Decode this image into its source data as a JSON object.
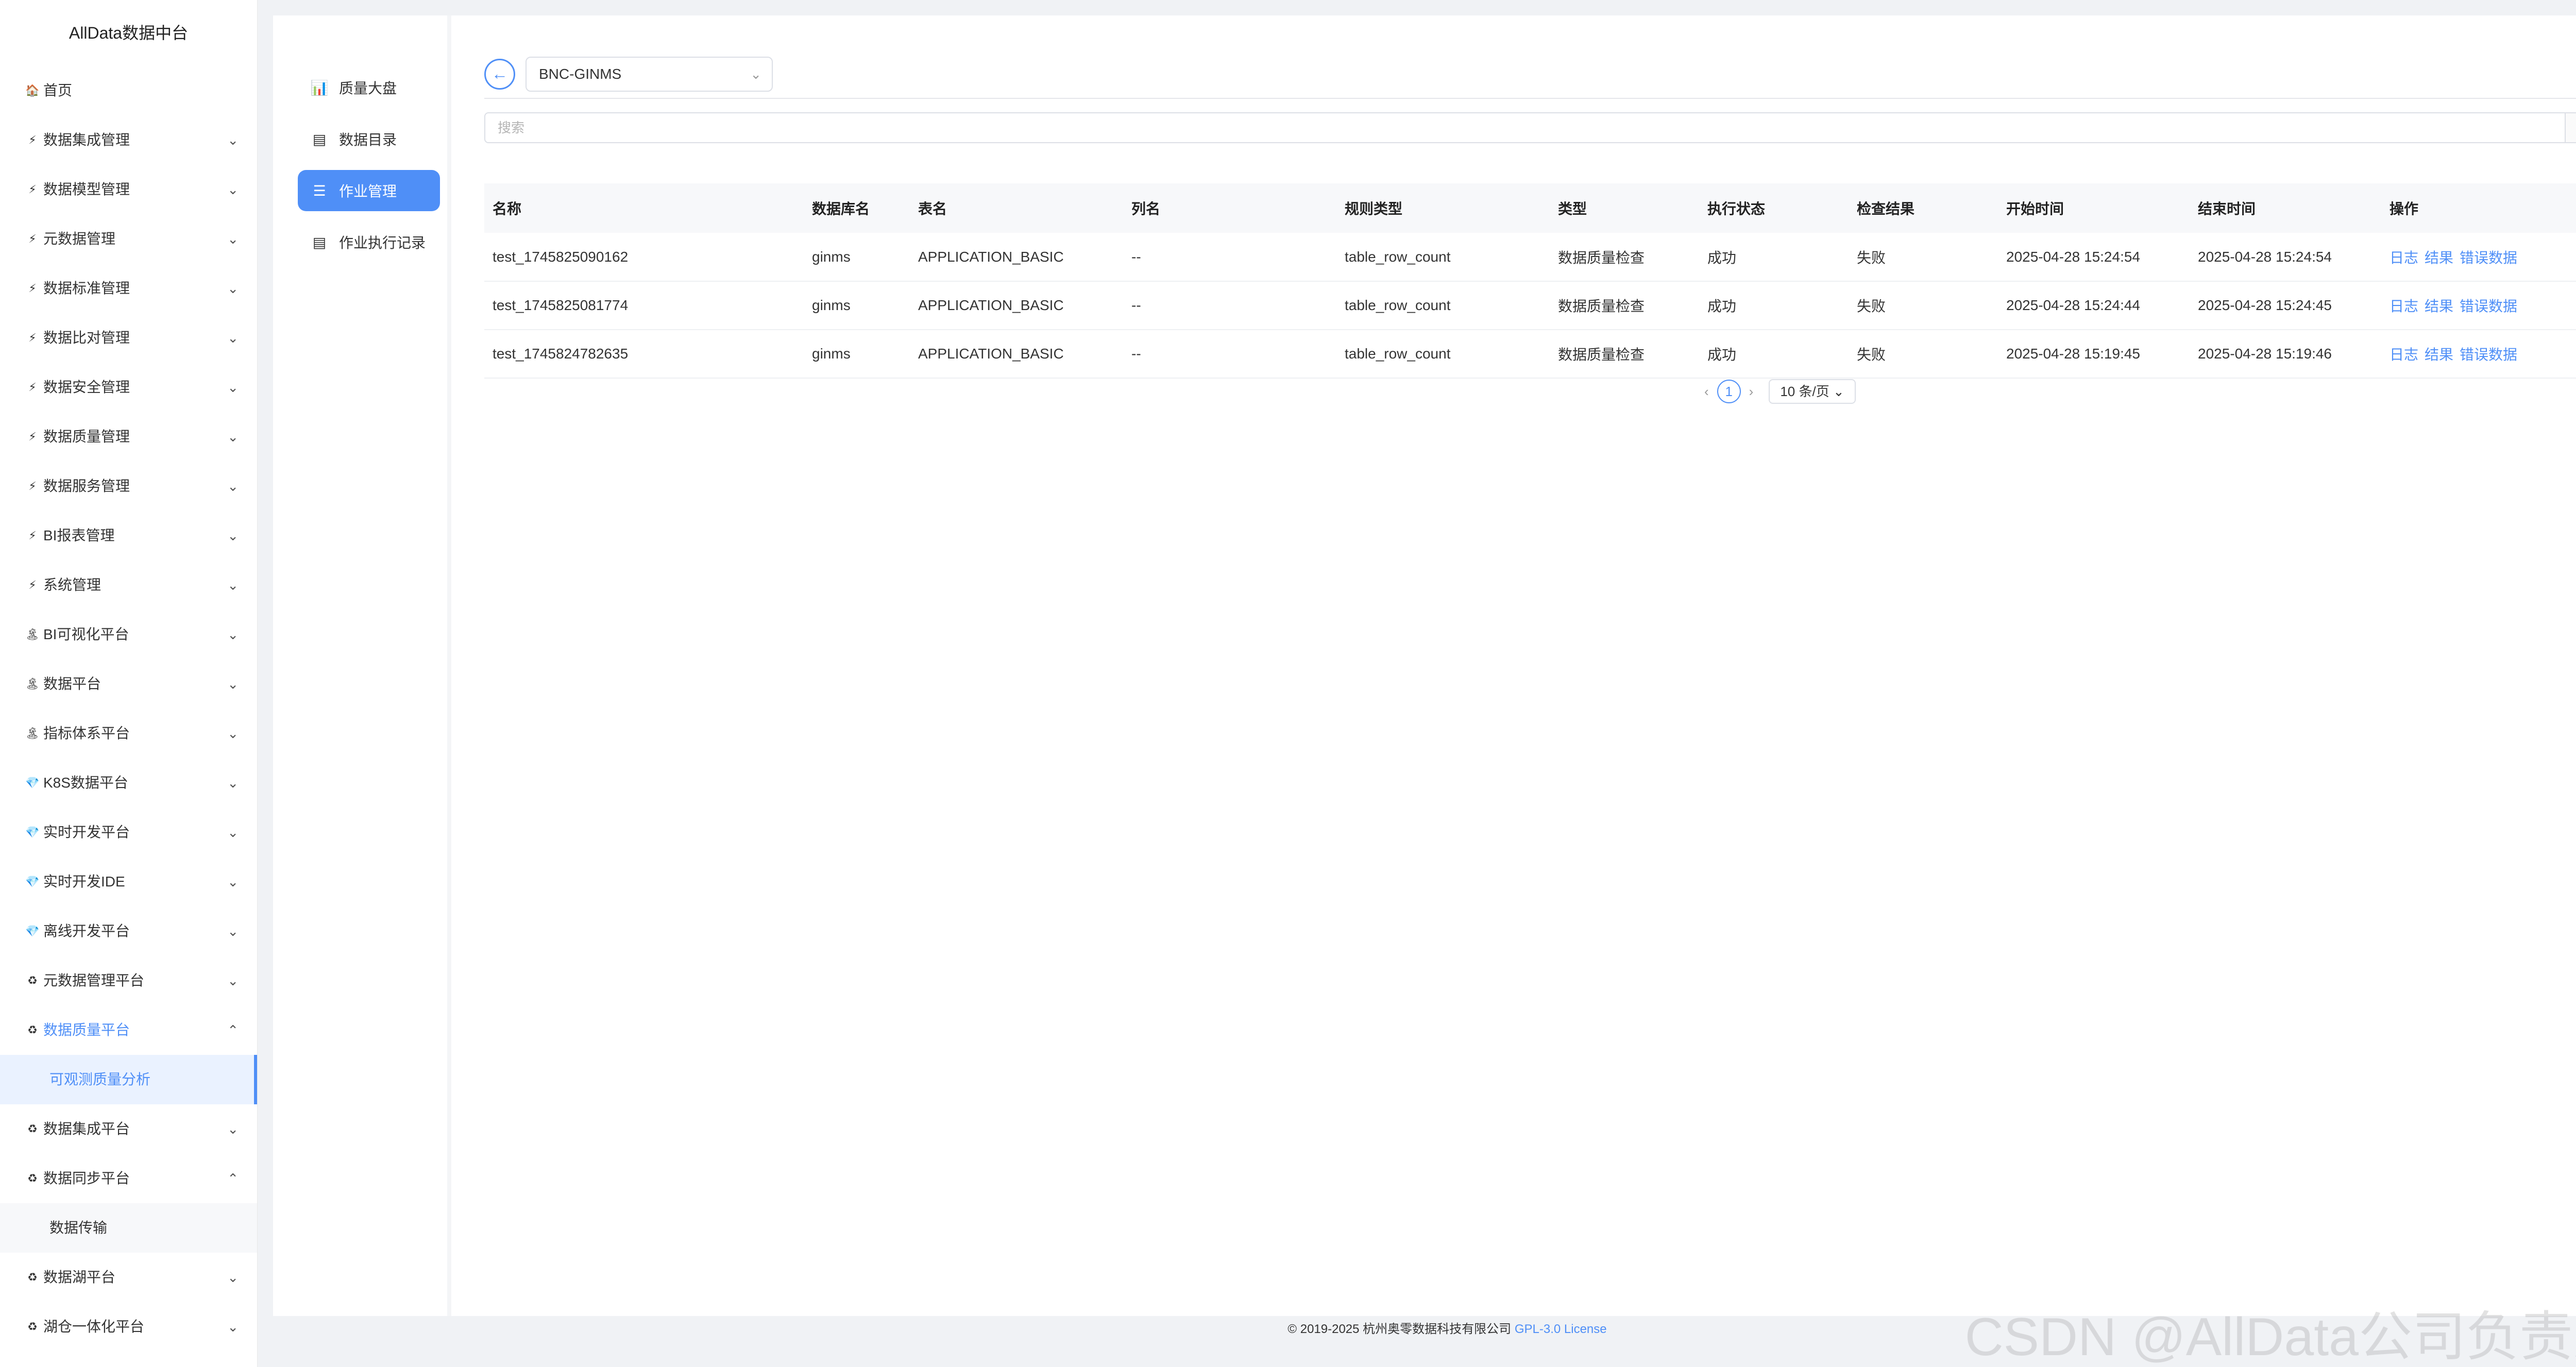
{
  "app": {
    "brand": "AllData数据中台"
  },
  "colors": {
    "accent": "#4f8ff7",
    "background": "#f0f2f5"
  },
  "sidebar": {
    "items": [
      {
        "label": "首页",
        "icon": "home-icon",
        "glyph": "🏠",
        "expanded": null
      },
      {
        "label": "数据集成管理",
        "icon": "bolt-icon",
        "glyph": "⚡",
        "expanded": false
      },
      {
        "label": "数据模型管理",
        "icon": "bolt-icon",
        "glyph": "⚡",
        "expanded": false
      },
      {
        "label": "元数据管理",
        "icon": "bolt-icon",
        "glyph": "⚡",
        "expanded": false
      },
      {
        "label": "数据标准管理",
        "icon": "bolt-icon",
        "glyph": "⚡",
        "expanded": false
      },
      {
        "label": "数据比对管理",
        "icon": "bolt-icon",
        "glyph": "⚡",
        "expanded": false
      },
      {
        "label": "数据安全管理",
        "icon": "bolt-icon",
        "glyph": "⚡",
        "expanded": false
      },
      {
        "label": "数据质量管理",
        "icon": "bolt-icon",
        "glyph": "⚡",
        "expanded": false
      },
      {
        "label": "数据服务管理",
        "icon": "bolt-icon",
        "glyph": "⚡",
        "expanded": false
      },
      {
        "label": "BI报表管理",
        "icon": "bolt-icon",
        "glyph": "⚡",
        "expanded": false
      },
      {
        "label": "系统管理",
        "icon": "bolt-icon",
        "glyph": "⚡",
        "expanded": false
      },
      {
        "label": "BI可视化平台",
        "icon": "tree-icon",
        "glyph": "🏝",
        "expanded": false
      },
      {
        "label": "数据平台",
        "icon": "tree-icon",
        "glyph": "🏝",
        "expanded": false
      },
      {
        "label": "指标体系平台",
        "icon": "tree-icon",
        "glyph": "🏝",
        "expanded": false
      },
      {
        "label": "K8S数据平台",
        "icon": "gem-icon",
        "glyph": "💎",
        "expanded": false
      },
      {
        "label": "实时开发平台",
        "icon": "gem-icon",
        "glyph": "💎",
        "expanded": false
      },
      {
        "label": "实时开发IDE",
        "icon": "gem-icon",
        "glyph": "💎",
        "expanded": false
      },
      {
        "label": "离线开发平台",
        "icon": "gem-icon",
        "glyph": "💎",
        "expanded": false
      },
      {
        "label": "元数据管理平台",
        "icon": "cycle-icon",
        "glyph": "♻",
        "expanded": false
      },
      {
        "label": "数据质量平台",
        "icon": "cycle-icon",
        "glyph": "♻",
        "expanded": true,
        "active": true,
        "children": [
          {
            "label": "可观测质量分析",
            "active": true
          }
        ]
      },
      {
        "label": "数据集成平台",
        "icon": "cycle-icon",
        "glyph": "♻",
        "expanded": false
      },
      {
        "label": "数据同步平台",
        "icon": "cycle-icon",
        "glyph": "♻",
        "expanded": true,
        "children": [
          {
            "label": "数据传输",
            "active": false
          }
        ]
      },
      {
        "label": "数据湖平台",
        "icon": "cycle-icon",
        "glyph": "♻",
        "expanded": false
      },
      {
        "label": "湖仓一体化平台",
        "icon": "cycle-icon",
        "glyph": "♻",
        "expanded": false
      }
    ]
  },
  "subnav": {
    "items": [
      {
        "label": "质量大盘",
        "icon": "bar-chart-icon",
        "glyph": "📊",
        "active": false
      },
      {
        "label": "数据目录",
        "icon": "catalog-icon",
        "glyph": "▤",
        "active": false
      },
      {
        "label": "作业管理",
        "icon": "list-icon",
        "glyph": "☰",
        "active": true
      },
      {
        "label": "作业执行记录",
        "icon": "record-icon",
        "glyph": "▤",
        "active": false
      }
    ]
  },
  "toolbar": {
    "back_glyph": "←",
    "database": "BNC-GINMS",
    "dropdown_glyph": "⌄"
  },
  "search": {
    "placeholder": "搜索",
    "button_glyph": "⌕"
  },
  "table": {
    "columns": [
      "名称",
      "数据库名",
      "表名",
      "列名",
      "规则类型",
      "类型",
      "执行状态",
      "检查结果",
      "开始时间",
      "结束时间",
      "操作"
    ],
    "rows": [
      {
        "name": "test_1745825090162",
        "database": "ginms",
        "table": "APPLICATION_BASIC",
        "column": "--",
        "rule_type": "table_row_count",
        "type": "数据质量检查",
        "status": "成功",
        "result": "失败",
        "start": "2025-04-28 15:24:54",
        "end": "2025-04-28 15:24:54"
      },
      {
        "name": "test_1745825081774",
        "database": "ginms",
        "table": "APPLICATION_BASIC",
        "column": "--",
        "rule_type": "table_row_count",
        "type": "数据质量检查",
        "status": "成功",
        "result": "失败",
        "start": "2025-04-28 15:24:44",
        "end": "2025-04-28 15:24:45"
      },
      {
        "name": "test_1745824782635",
        "database": "ginms",
        "table": "APPLICATION_BASIC",
        "column": "--",
        "rule_type": "table_row_count",
        "type": "数据质量检查",
        "status": "成功",
        "result": "失败",
        "start": "2025-04-28 15:19:45",
        "end": "2025-04-28 15:19:46"
      }
    ],
    "actions": [
      "日志",
      "结果",
      "错误数据"
    ]
  },
  "pagination": {
    "prev_glyph": "‹",
    "next_glyph": "›",
    "current": "1",
    "page_size": "10 条/页",
    "size_glyph": "⌄"
  },
  "footer": {
    "copyright": "© 2019-2025 杭州奥零数据科技有限公司",
    "license": "GPL-3.0 License"
  },
  "watermark": "CSDN @AllData公司负责人"
}
